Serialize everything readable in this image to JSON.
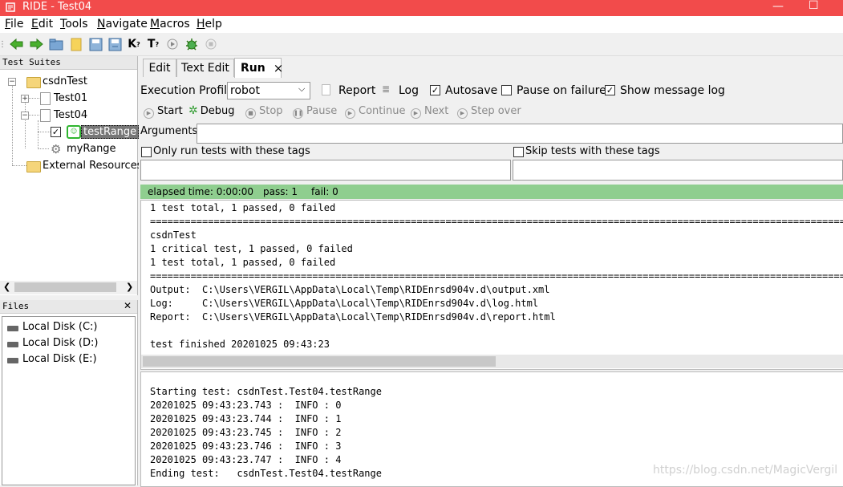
{
  "window": {
    "title": "RIDE - Test04",
    "minimize": "—",
    "maximize": "☐"
  },
  "menu": [
    {
      "label": "File"
    },
    {
      "label": "Edit"
    },
    {
      "label": "Tools"
    },
    {
      "label": "Navigate"
    },
    {
      "label": "Macros"
    },
    {
      "label": "Help"
    }
  ],
  "tree": {
    "header": "Test Suites",
    "nodes": {
      "root": "csdnTest",
      "test01": "Test01",
      "test04": "Test04",
      "testcase": "testRange",
      "keyword": "myRange",
      "external": "External Resources"
    }
  },
  "files": {
    "header": "Files",
    "close": "✕",
    "disks": [
      "Local Disk (C:)",
      "Local Disk (D:)",
      "Local Disk (E:)"
    ]
  },
  "tabs": {
    "edit": "Edit",
    "text_edit": "Text Edit",
    "run": "Run",
    "close": "×"
  },
  "run": {
    "profile_label": "Execution Profile:",
    "profile_value": "robot",
    "report": "Report",
    "log": "Log",
    "autosave": "Autosave",
    "pause_on_failure": "Pause on failure",
    "show_message_log": "Show message log",
    "start": "Start",
    "debug": "Debug",
    "stop": "Stop",
    "pause": "Pause",
    "continue": "Continue",
    "next": "Next",
    "step_over": "Step over",
    "arguments_label": "Arguments:",
    "only_run_tags": "Only run tests with these tags",
    "skip_tags": "Skip tests with these tags"
  },
  "status": {
    "elapsed": "elapsed time: 0:00:00",
    "pass": "pass: 1",
    "fail": "fail: 0",
    "color": "#8fce8f"
  },
  "output_lines": [
    "1 test total, 1 passed, 0 failed",
    "==============================================================================================================================",
    "csdnTest",
    "1 critical test, 1 passed, 0 failed",
    "1 test total, 1 passed, 0 failed",
    "==============================================================================================================================",
    "Output:  C:\\Users\\VERGIL\\AppData\\Local\\Temp\\RIDEnrsd904v.d\\output.xml",
    "Log:     C:\\Users\\VERGIL\\AppData\\Local\\Temp\\RIDEnrsd904v.d\\log.html",
    "Report:  C:\\Users\\VERGIL\\AppData\\Local\\Temp\\RIDEnrsd904v.d\\report.html",
    "",
    "test finished 20201025 09:43:23"
  ],
  "message_lines": [
    "",
    "Starting test: csdnTest.Test04.testRange",
    "20201025 09:43:23.743 :  INFO : 0",
    "20201025 09:43:23.744 :  INFO : 1",
    "20201025 09:43:23.745 :  INFO : 2",
    "20201025 09:43:23.746 :  INFO : 3",
    "20201025 09:43:23.747 :  INFO : 4",
    "Ending test:   csdnTest.Test04.testRange"
  ],
  "watermark": "https://blog.csdn.net/MagicVergil"
}
